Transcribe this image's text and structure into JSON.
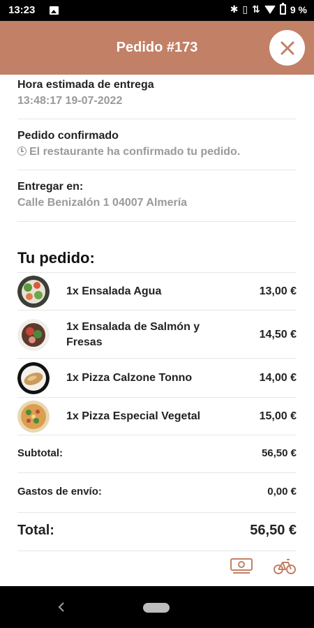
{
  "status_bar": {
    "time": "13:23",
    "battery_text": "9 %"
  },
  "header": {
    "title": "Pedido #173"
  },
  "delivery": {
    "time_label": "Hora estimada de entrega",
    "time_value": "13:48:17 19-07-2022",
    "status_label": "Pedido confirmado",
    "status_value": "El restaurante ha confirmado tu pedido.",
    "address_label": "Entregar en:",
    "address_value": "Calle Benizalón 1 04007 Almería"
  },
  "order": {
    "title": "Tu pedido:",
    "items": [
      {
        "name": "1x Ensalada Agua",
        "price": "13,00 €"
      },
      {
        "name": "1x Ensalada de Salmón y Fresas",
        "price": "14,50 €"
      },
      {
        "name": "1x Pizza Calzone Tonno",
        "price": "14,00 €"
      },
      {
        "name": "1x Pizza Especial Vegetal",
        "price": "15,00 €"
      }
    ]
  },
  "summary": {
    "subtotal_label": "Subtotal:",
    "subtotal_value": "56,50 €",
    "shipping_label": "Gastos de envío:",
    "shipping_value": "0,00 €",
    "total_label": "Total:",
    "total_value": "56,50 €"
  },
  "icons": {
    "payment": "cash-icon",
    "delivery": "bicycle-icon"
  },
  "colors": {
    "accent": "#c28066",
    "muted_text": "#9a9a9a"
  }
}
